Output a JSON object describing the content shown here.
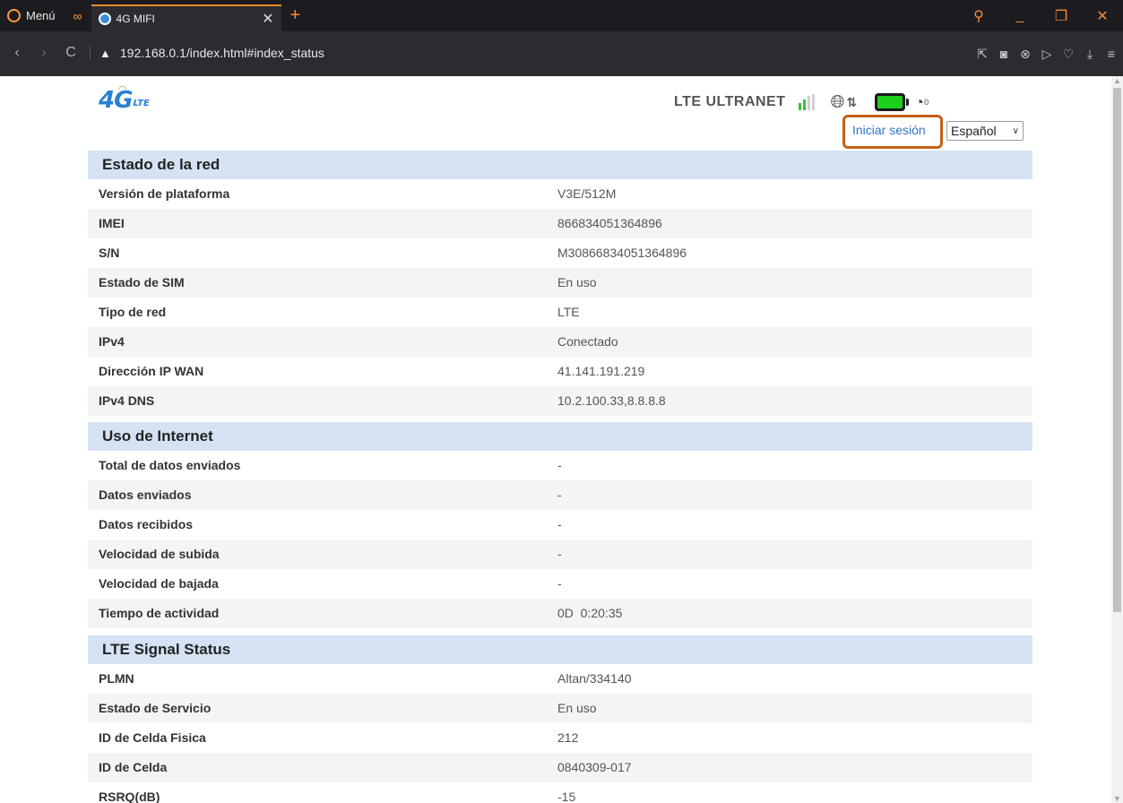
{
  "browser": {
    "menu_label": "Menú",
    "tab_title": "4G MIFI",
    "url": "192.168.0.1/index.html#index_status"
  },
  "header": {
    "logo_main": "4G",
    "logo_sub": "LTE",
    "operator": "LTE ULTRANET",
    "wifi_clients": "0",
    "login_link": "Iniciar sesión",
    "language": "Español"
  },
  "colors": {
    "section_bg": "#d5e2f3",
    "alt_row_bg": "#f4f4f4",
    "highlight": "#c4601a",
    "link": "#2e79c7",
    "battery": "#1ed01e"
  },
  "sections": [
    {
      "title": "Estado de la red",
      "rows": [
        {
          "label": "Versión de plataforma",
          "value": "V3E/512M"
        },
        {
          "label": "IMEI",
          "value": "866834051364896"
        },
        {
          "label": "S/N",
          "value": "M30866834051364896"
        },
        {
          "label": "Estado de SIM",
          "value": "En uso"
        },
        {
          "label": "Tipo de red",
          "value": "LTE"
        },
        {
          "label": "IPv4",
          "value": "Conectado"
        },
        {
          "label": "Dirección IP WAN",
          "value": "41.141.191.219"
        },
        {
          "label": "IPv4 DNS",
          "value": "10.2.100.33,8.8.8.8"
        }
      ]
    },
    {
      "title": "Uso de Internet",
      "rows": [
        {
          "label": "Total de datos enviados",
          "value": "-"
        },
        {
          "label": "Datos enviados",
          "value": "-"
        },
        {
          "label": "Datos recibidos",
          "value": "-"
        },
        {
          "label": "Velocidad de subida",
          "value": "-"
        },
        {
          "label": "Velocidad de bajada",
          "value": "-"
        },
        {
          "label": "Tiempo de actividad",
          "value": "0D  0:20:35"
        }
      ]
    },
    {
      "title": "LTE Signal Status",
      "rows": [
        {
          "label": "PLMN",
          "value": "Altan/334140"
        },
        {
          "label": "Estado de Servicio",
          "value": "En uso"
        },
        {
          "label": "ID de Celda Fisica",
          "value": "212"
        },
        {
          "label": "ID de Celda",
          "value": "0840309-017"
        },
        {
          "label": "RSRQ(dB)",
          "value": "-15"
        }
      ]
    }
  ]
}
